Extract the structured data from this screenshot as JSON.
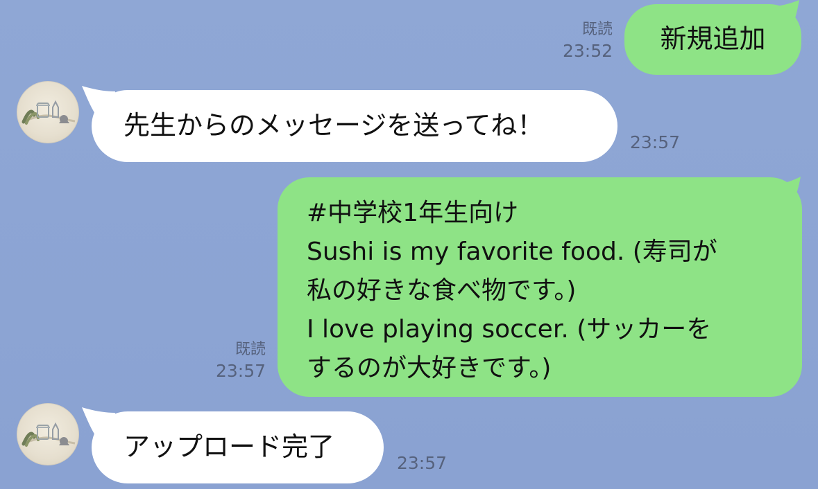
{
  "colors": {
    "chat_background": "#8CA3D3",
    "incoming_bubble": "#FFFFFF",
    "outgoing_bubble": "#8EE386",
    "meta_text": "#56627D"
  },
  "messages": [
    {
      "direction": "outgoing",
      "text": "新規追加",
      "read": "既読",
      "time": "23:52"
    },
    {
      "direction": "incoming",
      "avatar": "avatar",
      "text": "先生からのメッセージを送ってね！",
      "time": "23:57"
    },
    {
      "direction": "outgoing",
      "lines": [
        "#中学校1年生向け",
        "Sushi is my favorite food. (寿司が",
        "私の好きな食べ物です。)",
        "I love playing soccer. (サッカーを",
        "するのが大好きです。)"
      ],
      "read": "既読",
      "time": "23:57"
    },
    {
      "direction": "incoming",
      "avatar": "avatar",
      "text": "アップロード完了",
      "time": "23:57"
    }
  ]
}
